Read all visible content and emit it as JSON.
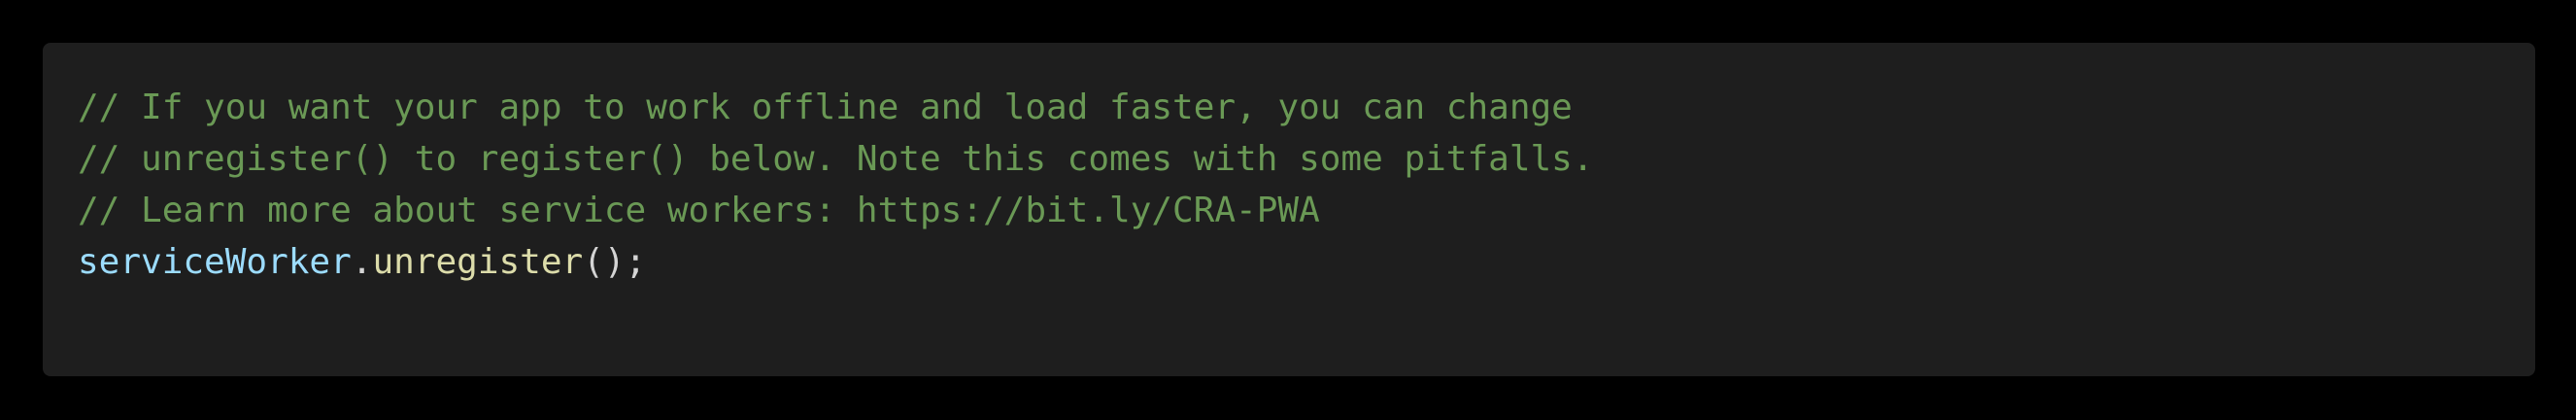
{
  "code": {
    "comment_lines": [
      "// If you want your app to work offline and load faster, you can change",
      "// unregister() to register() below. Note this comes with some pitfalls.",
      "// Learn more about service workers: https://bit.ly/CRA-PWA"
    ],
    "statement": {
      "object": "serviceWorker",
      "dot": ".",
      "method": "unregister",
      "tail": "();"
    }
  },
  "colors": {
    "background": "#000000",
    "panel": "#1e1e1e",
    "comment": "#6a9955",
    "variable": "#9cdcfe",
    "function": "#dcdcaa",
    "punctuation": "#d4d4d4"
  }
}
